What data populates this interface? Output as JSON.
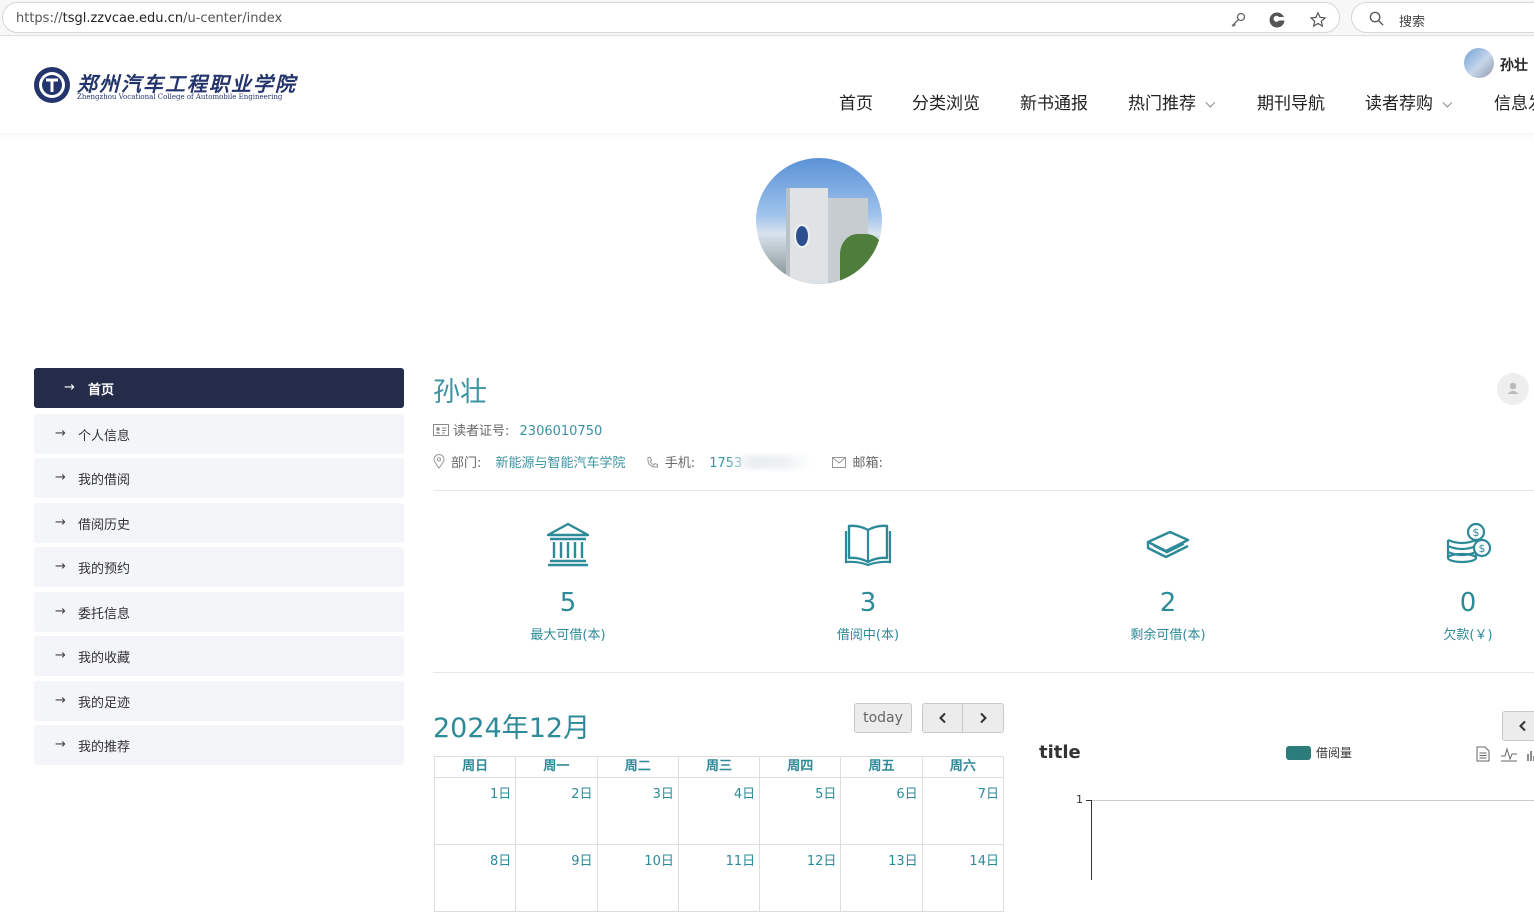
{
  "browser": {
    "url_prefix": "https://",
    "url_host": "tsgl.zzvcae.edu.cn",
    "url_path": "/u-center/index",
    "search_placeholder": "搜索"
  },
  "header": {
    "logo_name": "郑州汽车工程职业学院",
    "logo_en": "Zhengzhou Vocational College of Automobile Engineering",
    "user_name": "孙壮",
    "nav": [
      {
        "label": "首页",
        "dropdown": false
      },
      {
        "label": "分类浏览",
        "dropdown": false
      },
      {
        "label": "新书通报",
        "dropdown": false
      },
      {
        "label": "热门推荐",
        "dropdown": true
      },
      {
        "label": "期刊导航",
        "dropdown": false
      },
      {
        "label": "读者荐购",
        "dropdown": true
      },
      {
        "label": "信息发",
        "dropdown": false
      }
    ]
  },
  "sidebar": {
    "items": [
      {
        "label": "首页",
        "active": true
      },
      {
        "label": "个人信息",
        "active": false
      },
      {
        "label": "我的借阅",
        "active": false
      },
      {
        "label": "借阅历史",
        "active": false
      },
      {
        "label": "我的预约",
        "active": false
      },
      {
        "label": "委托信息",
        "active": false
      },
      {
        "label": "我的收藏",
        "active": false
      },
      {
        "label": "我的足迹",
        "active": false
      },
      {
        "label": "我的推荐",
        "active": false
      }
    ]
  },
  "profile": {
    "name": "孙壮",
    "card_label": "读者证号:",
    "card_no": "2306010750",
    "dept_label": "部门:",
    "dept": "新能源与智能汽车学院",
    "phone_label": "手机:",
    "phone_visible": "1753",
    "email_label": "邮箱:"
  },
  "stats": [
    {
      "icon": "bank-icon",
      "value": "5",
      "caption": "最大可借(本)"
    },
    {
      "icon": "open-book-icon",
      "value": "3",
      "caption": "借阅中(本)"
    },
    {
      "icon": "book-stack-icon",
      "value": "2",
      "caption": "剩余可借(本)"
    },
    {
      "icon": "coins-icon",
      "value": "0",
      "caption": "欠款(￥)"
    }
  ],
  "calendar": {
    "title": "2024年12月",
    "today_label": "today",
    "weekdays": [
      "周日",
      "周一",
      "周二",
      "周三",
      "周四",
      "周五",
      "周六"
    ],
    "rows": [
      [
        "1日",
        "2日",
        "3日",
        "4日",
        "5日",
        "6日",
        "7日"
      ],
      [
        "8日",
        "9日",
        "10日",
        "11日",
        "12日",
        "13日",
        "14日"
      ]
    ]
  },
  "chart": {
    "title": "title",
    "legend": "借阅量",
    "y_tick": "1"
  },
  "colors": {
    "accent": "#2d8a98",
    "sidebar_active": "#252c4a",
    "legend": "#2c7c7c"
  }
}
